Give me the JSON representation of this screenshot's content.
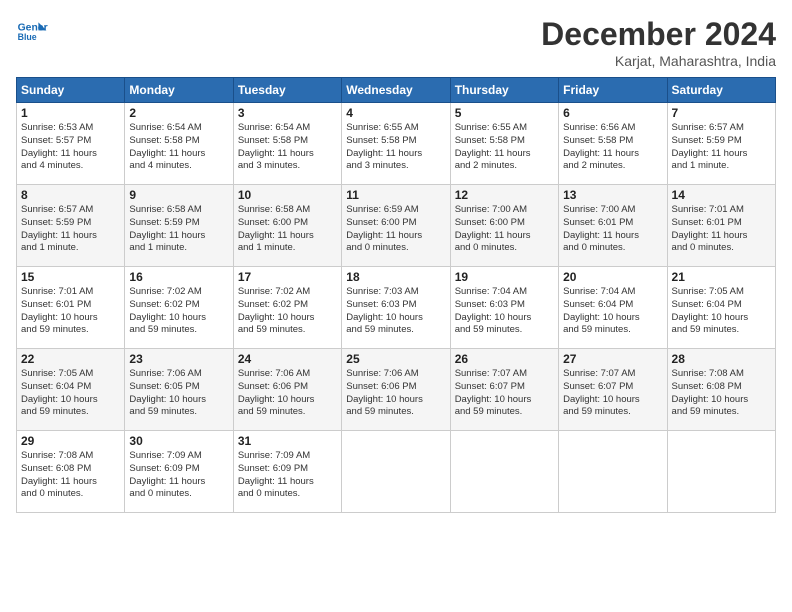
{
  "header": {
    "logo_line1": "General",
    "logo_line2": "Blue",
    "month_title": "December 2024",
    "location": "Karjat, Maharashtra, India"
  },
  "days_of_week": [
    "Sunday",
    "Monday",
    "Tuesday",
    "Wednesday",
    "Thursday",
    "Friday",
    "Saturday"
  ],
  "weeks": [
    [
      {
        "day": "1",
        "info": "Sunrise: 6:53 AM\nSunset: 5:57 PM\nDaylight: 11 hours\nand 4 minutes."
      },
      {
        "day": "2",
        "info": "Sunrise: 6:54 AM\nSunset: 5:58 PM\nDaylight: 11 hours\nand 4 minutes."
      },
      {
        "day": "3",
        "info": "Sunrise: 6:54 AM\nSunset: 5:58 PM\nDaylight: 11 hours\nand 3 minutes."
      },
      {
        "day": "4",
        "info": "Sunrise: 6:55 AM\nSunset: 5:58 PM\nDaylight: 11 hours\nand 3 minutes."
      },
      {
        "day": "5",
        "info": "Sunrise: 6:55 AM\nSunset: 5:58 PM\nDaylight: 11 hours\nand 2 minutes."
      },
      {
        "day": "6",
        "info": "Sunrise: 6:56 AM\nSunset: 5:58 PM\nDaylight: 11 hours\nand 2 minutes."
      },
      {
        "day": "7",
        "info": "Sunrise: 6:57 AM\nSunset: 5:59 PM\nDaylight: 11 hours\nand 1 minute."
      }
    ],
    [
      {
        "day": "8",
        "info": "Sunrise: 6:57 AM\nSunset: 5:59 PM\nDaylight: 11 hours\nand 1 minute."
      },
      {
        "day": "9",
        "info": "Sunrise: 6:58 AM\nSunset: 5:59 PM\nDaylight: 11 hours\nand 1 minute."
      },
      {
        "day": "10",
        "info": "Sunrise: 6:58 AM\nSunset: 6:00 PM\nDaylight: 11 hours\nand 1 minute."
      },
      {
        "day": "11",
        "info": "Sunrise: 6:59 AM\nSunset: 6:00 PM\nDaylight: 11 hours\nand 0 minutes."
      },
      {
        "day": "12",
        "info": "Sunrise: 7:00 AM\nSunset: 6:00 PM\nDaylight: 11 hours\nand 0 minutes."
      },
      {
        "day": "13",
        "info": "Sunrise: 7:00 AM\nSunset: 6:01 PM\nDaylight: 11 hours\nand 0 minutes."
      },
      {
        "day": "14",
        "info": "Sunrise: 7:01 AM\nSunset: 6:01 PM\nDaylight: 11 hours\nand 0 minutes."
      }
    ],
    [
      {
        "day": "15",
        "info": "Sunrise: 7:01 AM\nSunset: 6:01 PM\nDaylight: 10 hours\nand 59 minutes."
      },
      {
        "day": "16",
        "info": "Sunrise: 7:02 AM\nSunset: 6:02 PM\nDaylight: 10 hours\nand 59 minutes."
      },
      {
        "day": "17",
        "info": "Sunrise: 7:02 AM\nSunset: 6:02 PM\nDaylight: 10 hours\nand 59 minutes."
      },
      {
        "day": "18",
        "info": "Sunrise: 7:03 AM\nSunset: 6:03 PM\nDaylight: 10 hours\nand 59 minutes."
      },
      {
        "day": "19",
        "info": "Sunrise: 7:04 AM\nSunset: 6:03 PM\nDaylight: 10 hours\nand 59 minutes."
      },
      {
        "day": "20",
        "info": "Sunrise: 7:04 AM\nSunset: 6:04 PM\nDaylight: 10 hours\nand 59 minutes."
      },
      {
        "day": "21",
        "info": "Sunrise: 7:05 AM\nSunset: 6:04 PM\nDaylight: 10 hours\nand 59 minutes."
      }
    ],
    [
      {
        "day": "22",
        "info": "Sunrise: 7:05 AM\nSunset: 6:04 PM\nDaylight: 10 hours\nand 59 minutes."
      },
      {
        "day": "23",
        "info": "Sunrise: 7:06 AM\nSunset: 6:05 PM\nDaylight: 10 hours\nand 59 minutes."
      },
      {
        "day": "24",
        "info": "Sunrise: 7:06 AM\nSunset: 6:06 PM\nDaylight: 10 hours\nand 59 minutes."
      },
      {
        "day": "25",
        "info": "Sunrise: 7:06 AM\nSunset: 6:06 PM\nDaylight: 10 hours\nand 59 minutes."
      },
      {
        "day": "26",
        "info": "Sunrise: 7:07 AM\nSunset: 6:07 PM\nDaylight: 10 hours\nand 59 minutes."
      },
      {
        "day": "27",
        "info": "Sunrise: 7:07 AM\nSunset: 6:07 PM\nDaylight: 10 hours\nand 59 minutes."
      },
      {
        "day": "28",
        "info": "Sunrise: 7:08 AM\nSunset: 6:08 PM\nDaylight: 10 hours\nand 59 minutes."
      }
    ],
    [
      {
        "day": "29",
        "info": "Sunrise: 7:08 AM\nSunset: 6:08 PM\nDaylight: 11 hours\nand 0 minutes."
      },
      {
        "day": "30",
        "info": "Sunrise: 7:09 AM\nSunset: 6:09 PM\nDaylight: 11 hours\nand 0 minutes."
      },
      {
        "day": "31",
        "info": "Sunrise: 7:09 AM\nSunset: 6:09 PM\nDaylight: 11 hours\nand 0 minutes."
      },
      {
        "day": "",
        "info": ""
      },
      {
        "day": "",
        "info": ""
      },
      {
        "day": "",
        "info": ""
      },
      {
        "day": "",
        "info": ""
      }
    ]
  ]
}
